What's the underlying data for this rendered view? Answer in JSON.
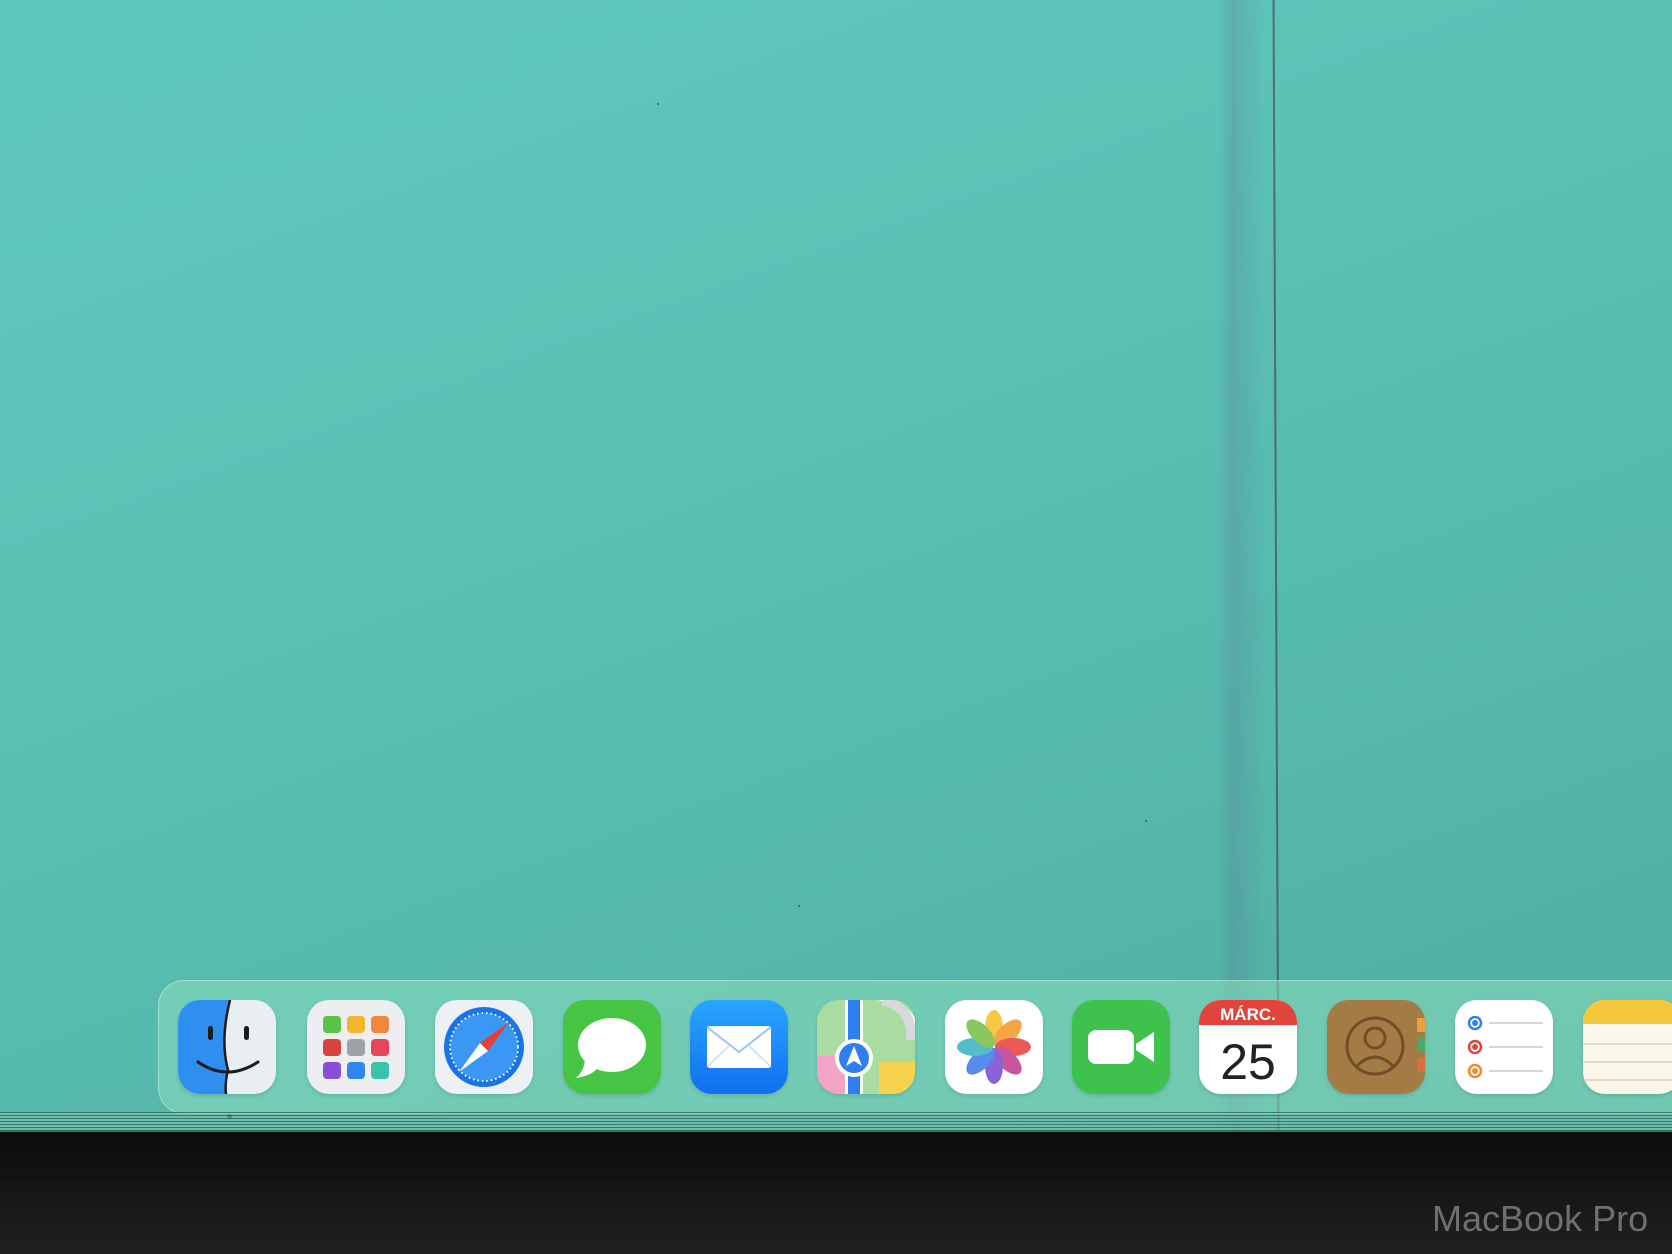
{
  "dock": {
    "apps": [
      {
        "name": "Finder",
        "icon": "finder-icon"
      },
      {
        "name": "Launchpad",
        "icon": "launchpad-icon"
      },
      {
        "name": "Safari",
        "icon": "safari-icon"
      },
      {
        "name": "Messages",
        "icon": "messages-icon"
      },
      {
        "name": "Mail",
        "icon": "mail-icon"
      },
      {
        "name": "Maps",
        "icon": "maps-icon"
      },
      {
        "name": "Photos",
        "icon": "photos-icon"
      },
      {
        "name": "FaceTime",
        "icon": "facetime-icon"
      },
      {
        "name": "Calendar",
        "icon": "calendar-icon"
      },
      {
        "name": "Contacts",
        "icon": "contacts-icon"
      },
      {
        "name": "Reminders",
        "icon": "reminders-icon"
      },
      {
        "name": "Notes",
        "icon": "notes-icon"
      }
    ],
    "calendar": {
      "month": "MÁRC.",
      "day": "25"
    }
  },
  "bezel": {
    "brand_label": "MacBook Pro"
  },
  "colors": {
    "wallpaper": "#5bc2b6",
    "accent_red": "#e0443a",
    "dock_bg": "#8cdcbe"
  }
}
